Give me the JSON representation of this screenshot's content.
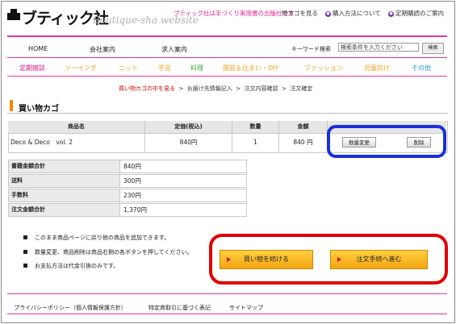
{
  "header": {
    "logo_jp": "ブティック社",
    "logo_en": "Boutique-sha website",
    "tagline": "ブティック社は手づくり実用書の出版社です",
    "links": [
      "物カゴを見る",
      "購入方法について",
      "定期購読のご案内"
    ]
  },
  "nav": {
    "items": [
      "HOME",
      "会社案内",
      "求人案内"
    ],
    "keyword_label": "キーワード検索",
    "keyword_placeholder": "検索条件を入力ください",
    "search_button": "検索"
  },
  "categories": [
    {
      "label": "定期雑誌",
      "color": "#e0138a"
    },
    {
      "label": "ソーイング",
      "color": "#f2a21a"
    },
    {
      "label": "ニット",
      "color": "#f2a21a"
    },
    {
      "label": "手芸",
      "color": "#f2a21a"
    },
    {
      "label": "料理",
      "color": "#3aa83a"
    },
    {
      "label": "園芸＆住まい・DIY",
      "color": "#f2a21a"
    },
    {
      "label": "ファッション",
      "color": "#f2a21a"
    },
    {
      "label": "児童向け",
      "color": "#f2a21a"
    },
    {
      "label": "その他",
      "color": "#2a9ad8"
    }
  ],
  "steps": {
    "current": "買い物カゴの中を見る",
    "rest": [
      "お届け先情報記入",
      "注文内容確認",
      "注文確定"
    ],
    "sep": ">"
  },
  "section_title": "買い物カゴ",
  "cart": {
    "headers": [
      "商品名",
      "定価(税込)",
      "数量",
      "金額"
    ],
    "row": {
      "name": "Deco & Deco　vol. 2",
      "price": "840円",
      "qty": "1",
      "amount": "840 円",
      "change_button": "数量変更",
      "delete_button": "削除"
    }
  },
  "totals": [
    {
      "label": "書籍金額合計",
      "value": "840円"
    },
    {
      "label": "送料",
      "value": "300円"
    },
    {
      "label": "手数料",
      "value": "230円"
    },
    {
      "label": "注文金額合計",
      "value": "1,370円"
    }
  ],
  "notes": [
    "このまま商品ページに戻り他の商品を追加できます。",
    "数量変更、商品削除は商品右側の各ボタンを押してください。",
    "お支払方法は代金引換のみです。"
  ],
  "actions": {
    "continue": "買い物を続ける",
    "checkout": "注文手続へ進む"
  },
  "footer": [
    "プライバシーポリシー（個人情報保護方針）",
    "特定商取引に基づく表記",
    "サイトマップ"
  ]
}
